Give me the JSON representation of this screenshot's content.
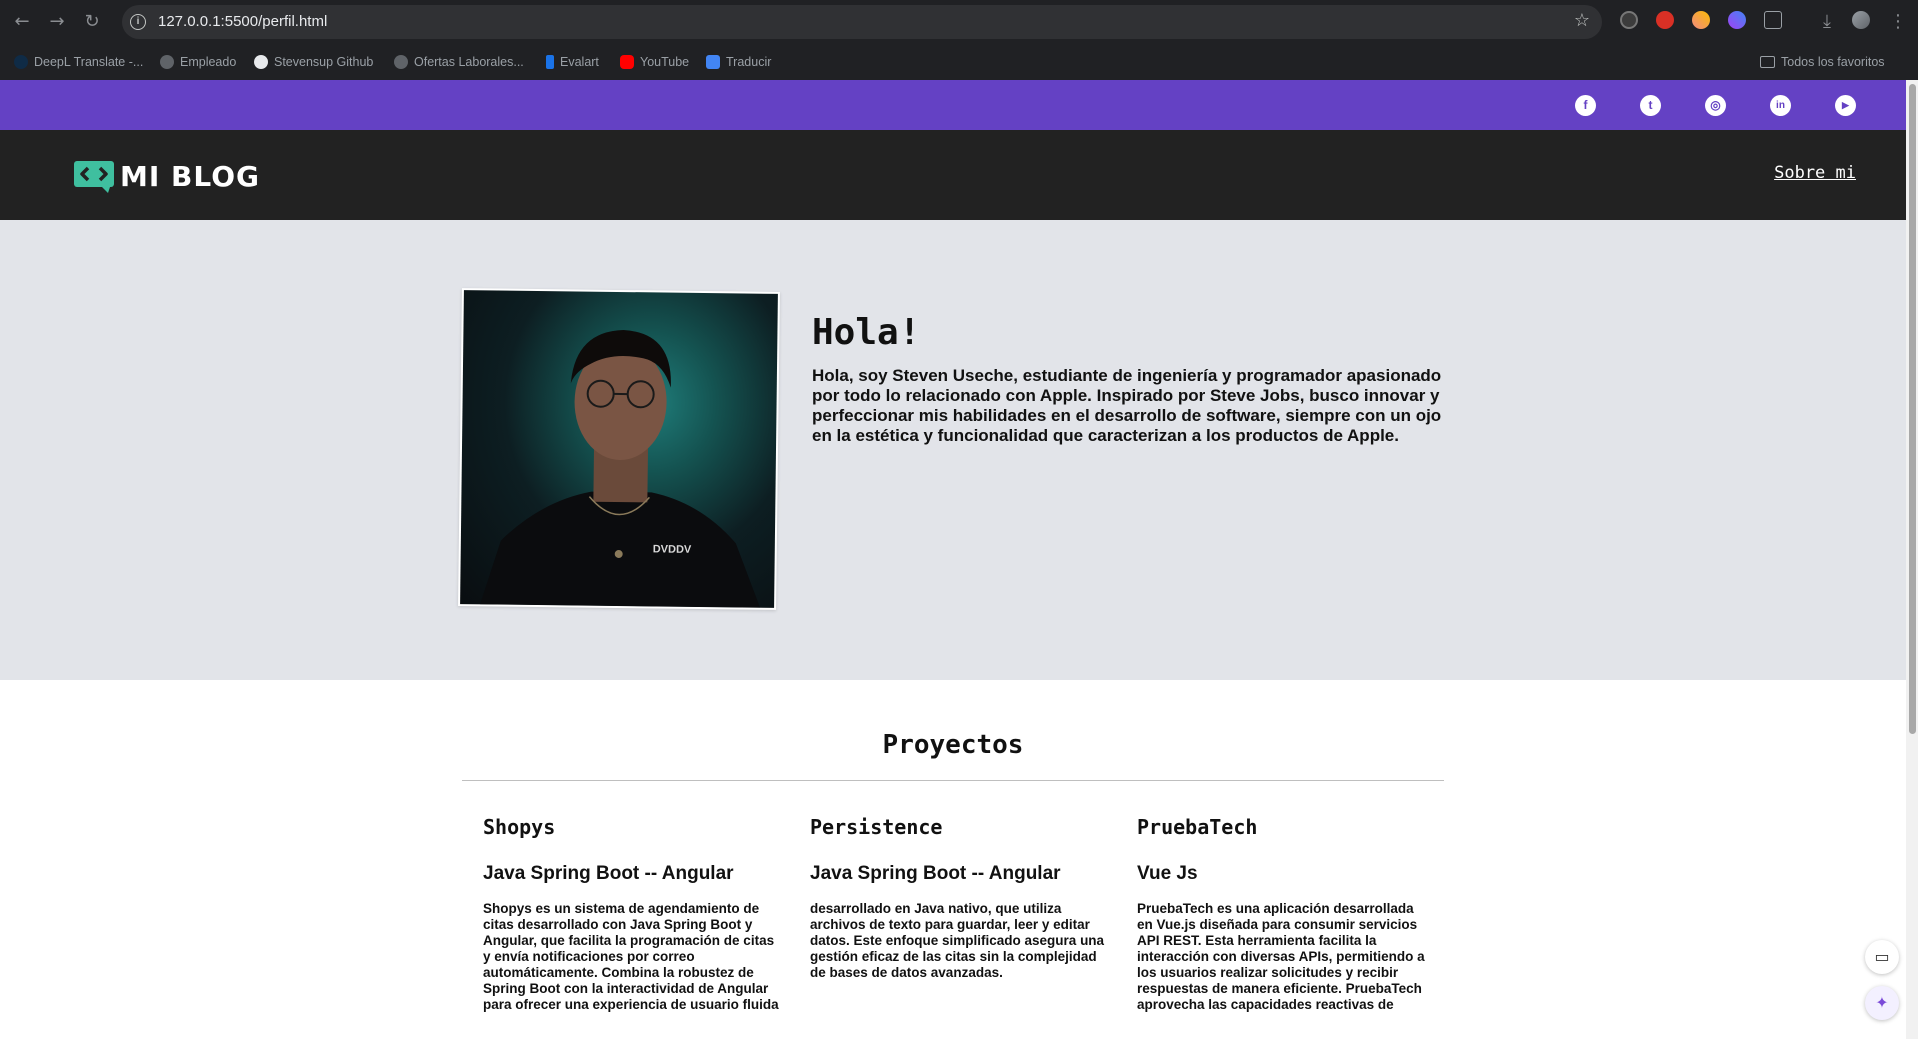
{
  "browser": {
    "url": "127.0.0.1:5500/perfil.html",
    "bookmarks": [
      {
        "label": "DeepL Translate -..."
      },
      {
        "label": "Empleado"
      },
      {
        "label": "Stevensup Github"
      },
      {
        "label": "Ofertas Laborales..."
      },
      {
        "label": "Evalart"
      },
      {
        "label": "YouTube"
      },
      {
        "label": "Traducir"
      }
    ],
    "all_bookmarks": "Todos los favoritos"
  },
  "social": [
    {
      "name": "facebook",
      "glyph": "f"
    },
    {
      "name": "tumblr",
      "glyph": "t"
    },
    {
      "name": "instagram",
      "glyph": "◎"
    },
    {
      "name": "linkedin",
      "glyph": "in"
    },
    {
      "name": "youtube",
      "glyph": "▶"
    }
  ],
  "header": {
    "logo_text": "MI BLOG",
    "nav_about": "Sobre mi"
  },
  "hero": {
    "title": "Hola!",
    "text": "Hola, soy Steven Useche, estudiante de ingeniería y programador apasionado por todo lo relacionado con Apple. Inspirado por Steve Jobs, busco innovar y perfeccionar mis habilidades en el desarrollo de software, siempre con un ojo en la estética y funcionalidad que caracterizan a los productos de Apple.",
    "shirt_text": "DVDDV"
  },
  "projects": {
    "title": "Proyectos",
    "items": [
      {
        "name": "Shopys",
        "tech": "Java Spring Boot -- Angular",
        "description": "Shopys es un sistema de agendamiento de citas desarrollado con Java Spring Boot y Angular, que facilita la programación de citas y envía notificaciones por correo automáticamente. Combina la robustez de Spring Boot con la interactividad de Angular para ofrecer una experiencia de usuario fluida"
      },
      {
        "name": "Persistence",
        "tech": "Java Spring Boot -- Angular",
        "description": "desarrollado en Java nativo, que utiliza archivos de texto para guardar, leer y editar datos. Este enfoque simplificado asegura una gestión eficaz de las citas sin la complejidad de bases de datos avanzadas."
      },
      {
        "name": "PruebaTech",
        "tech": "Vue Js",
        "description": "PruebaTech es una aplicación desarrollada en Vue.js diseñada para consumir servicios API REST. Esta herramienta facilita la interacción con diversas APIs, permitiendo a los usuarios realizar solicitudes y recibir respuestas de manera eficiente. PruebaTech aprovecha las capacidades reactivas de"
      }
    ]
  },
  "colors": {
    "topbar": "#6441c4",
    "header": "#222222",
    "hero_bg": "#e2e4e9",
    "logo_accent": "#3fbf9f"
  }
}
